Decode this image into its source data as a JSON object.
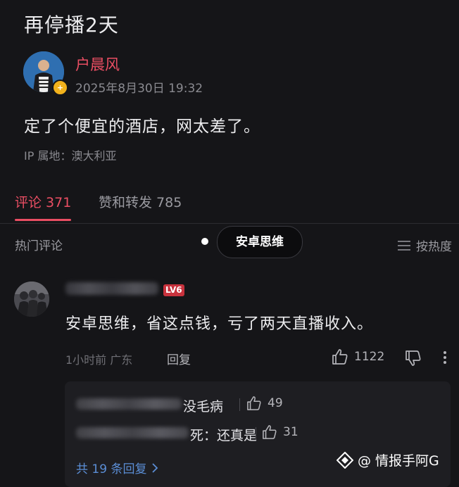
{
  "post": {
    "title": "再停播2天",
    "author": "户晨风",
    "timestamp": "2025年8月30日 19:32",
    "text": "定了个便宜的酒店，网太差了。",
    "ip_location": "IP 属地：澳大利亚",
    "verified_badge": "+"
  },
  "tabs": [
    {
      "label": "评论 371",
      "active": true
    },
    {
      "label": "赞和转发 785",
      "active": false
    }
  ],
  "comments_header": {
    "hot_label": "热门评论",
    "floating_pill": "安卓思维",
    "sort_label": "按热度"
  },
  "comment": {
    "level_badge": "LV6",
    "text": "安卓思维，省这点钱，亏了两天直播收入。",
    "meta": "1小时前 广东",
    "reply_label": "回复",
    "like_count": "1122",
    "replies": [
      {
        "text": "没毛病",
        "like_count": "49"
      },
      {
        "text": "死：还真是",
        "like_count": "31"
      }
    ],
    "more_replies": "共 19 条回复"
  },
  "watermark": "@ 情报手阿G",
  "colors": {
    "accent": "#ea4e63",
    "link": "#5b8ed6",
    "background": "#151518"
  }
}
